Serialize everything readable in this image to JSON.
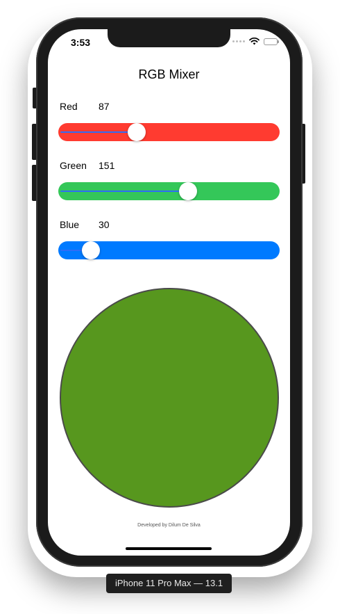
{
  "status_bar": {
    "time": "3:53"
  },
  "app": {
    "title": "RGB Mixer"
  },
  "sliders": [
    {
      "label": "Red",
      "value": "87",
      "fraction": 0.3412,
      "color": "#FF3B30",
      "fill_color": "#2F6DF6"
    },
    {
      "label": "Green",
      "value": "151",
      "fraction": 0.5922,
      "color": "#34C759",
      "fill_color": "#2F6DF6"
    },
    {
      "label": "Blue",
      "value": "30",
      "fraction": 0.1176,
      "color": "#007AFF",
      "fill_color": "#2F6DF6"
    }
  ],
  "preview": {
    "color": "#57971E",
    "border_color": "#4A4A4A"
  },
  "footer": {
    "credit": "Developed by Dilum De Silva"
  },
  "device": {
    "caption": "iPhone 11 Pro Max — 13.1"
  }
}
